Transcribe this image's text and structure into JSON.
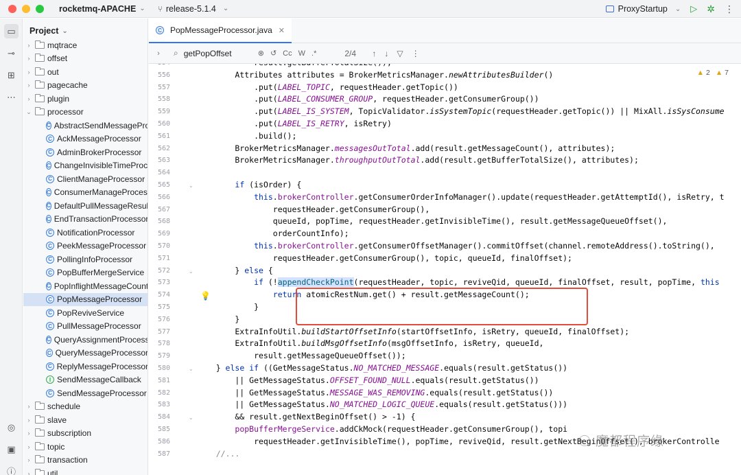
{
  "titlebar": {
    "project": "rocketmq-APACHE",
    "branch": "release-5.1.4",
    "run_config": "ProxyStartup"
  },
  "project_panel": {
    "title": "Project",
    "items": [
      {
        "label": "mqtrace",
        "type": "folder",
        "expanded": false
      },
      {
        "label": "offset",
        "type": "folder",
        "expanded": false
      },
      {
        "label": "out",
        "type": "folder",
        "expanded": false
      },
      {
        "label": "pagecache",
        "type": "folder",
        "expanded": false
      },
      {
        "label": "plugin",
        "type": "folder",
        "expanded": false
      },
      {
        "label": "processor",
        "type": "folder",
        "expanded": true
      },
      {
        "label": "AbstractSendMessageProcessor",
        "type": "class"
      },
      {
        "label": "AckMessageProcessor",
        "type": "class"
      },
      {
        "label": "AdminBrokerProcessor",
        "type": "class"
      },
      {
        "label": "ChangeInvisibleTimeProcessor",
        "type": "class"
      },
      {
        "label": "ClientManageProcessor",
        "type": "class"
      },
      {
        "label": "ConsumerManageProcessor",
        "type": "class"
      },
      {
        "label": "DefaultPullMessageResultHandler",
        "type": "class"
      },
      {
        "label": "EndTransactionProcessor",
        "type": "class"
      },
      {
        "label": "NotificationProcessor",
        "type": "class"
      },
      {
        "label": "PeekMessageProcessor",
        "type": "class"
      },
      {
        "label": "PollingInfoProcessor",
        "type": "class"
      },
      {
        "label": "PopBufferMergeService",
        "type": "class"
      },
      {
        "label": "PopInflightMessageCounter",
        "type": "class"
      },
      {
        "label": "PopMessageProcessor",
        "type": "class",
        "selected": true
      },
      {
        "label": "PopReviveService",
        "type": "class"
      },
      {
        "label": "PullMessageProcessor",
        "type": "class"
      },
      {
        "label": "QueryAssignmentProcessor",
        "type": "class"
      },
      {
        "label": "QueryMessageProcessor",
        "type": "class"
      },
      {
        "label": "ReplyMessageProcessor",
        "type": "class"
      },
      {
        "label": "SendMessageCallback",
        "type": "interface"
      },
      {
        "label": "SendMessageProcessor",
        "type": "class"
      },
      {
        "label": "schedule",
        "type": "folder",
        "expanded": false
      },
      {
        "label": "slave",
        "type": "folder",
        "expanded": false
      },
      {
        "label": "subscription",
        "type": "folder",
        "expanded": false
      },
      {
        "label": "topic",
        "type": "folder",
        "expanded": false
      },
      {
        "label": "transaction",
        "type": "folder",
        "expanded": false
      },
      {
        "label": "util",
        "type": "folder",
        "expanded": false
      }
    ]
  },
  "editor": {
    "tab_label": "PopMessageProcessor.java",
    "find": {
      "query": "getPopOffset",
      "count": "2/4",
      "options": [
        "Cc",
        "W",
        ".*"
      ]
    },
    "inspections": {
      "warnings": "2",
      "weak_warnings": "7"
    },
    "line_numbers": [
      "554",
      "556",
      "557",
      "558",
      "559",
      "560",
      "561",
      "562",
      "563",
      "564",
      "565",
      "566",
      "567",
      "568",
      "569",
      "570",
      "571",
      "572",
      "573",
      "574",
      "575",
      "576",
      "577",
      "578",
      "579",
      "580",
      "581",
      "582",
      "583",
      "584",
      "585",
      "586",
      "587"
    ],
    "code_lines": [
      "            result.getBufferTotalSize());",
      "        Attributes attributes = BrokerMetricsManager.newAttributesBuilder()",
      "            .put(LABEL_TOPIC, requestHeader.getTopic())",
      "            .put(LABEL_CONSUMER_GROUP, requestHeader.getConsumerGroup())",
      "            .put(LABEL_IS_SYSTEM, TopicValidator.isSystemTopic(requestHeader.getTopic()) || MixAll.isSysConsume",
      "            .put(LABEL_IS_RETRY, isRetry)",
      "            .build();",
      "        BrokerMetricsManager.messagesOutTotal.add(result.getMessageCount(), attributes);",
      "        BrokerMetricsManager.throughputOutTotal.add(result.getBufferTotalSize(), attributes);",
      "",
      "        if (isOrder) {",
      "            this.brokerController.getConsumerOrderInfoManager().update(requestHeader.getAttemptId(), isRetry, t",
      "                requestHeader.getConsumerGroup(),",
      "                queueId, popTime, requestHeader.getInvisibleTime(), result.getMessageQueueOffset(),",
      "                orderCountInfo);",
      "            this.brokerController.getConsumerOffsetManager().commitOffset(channel.remoteAddress().toString(),",
      "                requestHeader.getConsumerGroup(), topic, queueId, finalOffset);",
      "        } else {",
      "            if (!appendCheckPoint(requestHeader, topic, reviveQid, queueId, finalOffset, result, popTime, this",
      "                return atomicRestNum.get() + result.getMessageCount();",
      "            }",
      "        }",
      "        ExtraInfoUtil.buildStartOffsetInfo(startOffsetInfo, isRetry, queueId, finalOffset);",
      "        ExtraInfoUtil.buildMsgOffsetInfo(msgOffsetInfo, isRetry, queueId,",
      "            result.getMessageQueueOffset());",
      "    } else if ((GetMessageStatus.NO_MATCHED_MESSAGE.equals(result.getStatus())",
      "        || GetMessageStatus.OFFSET_FOUND_NULL.equals(result.getStatus())",
      "        || GetMessageStatus.MESSAGE_WAS_REMOVING.equals(result.getStatus())",
      "        || GetMessageStatus.NO_MATCHED_LOGIC_QUEUE.equals(result.getStatus()))",
      "        && result.getNextBeginOffset() > -1) {",
      "        popBufferMergeService.addCkMock(requestHeader.getConsumerGroup(), topi",
      "            requestHeader.getInvisibleTime(), popTime, reviveQid, result.getNextBeginOffset(), brokerControlle",
      "    //..."
    ]
  },
  "watermark": "魔都程序缘"
}
